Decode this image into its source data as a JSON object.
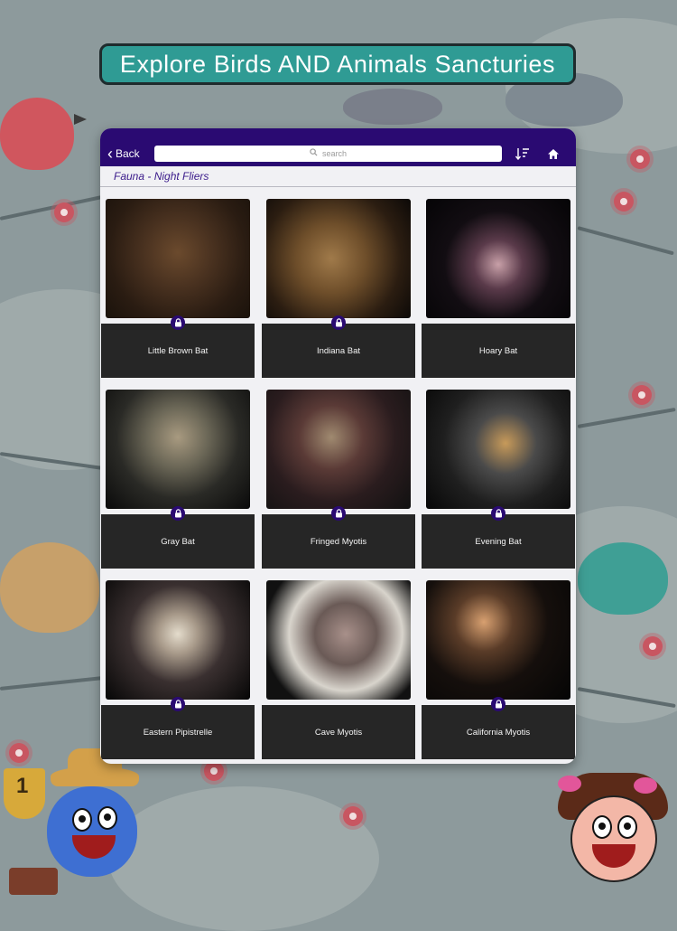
{
  "banner": {
    "title": "Explore Birds AND Animals Sancturies"
  },
  "nav": {
    "back_label": "Back",
    "search_placeholder": "search"
  },
  "breadcrumb": {
    "text": "Fauna - Night Fliers"
  },
  "colors": {
    "nav_bg": "#2a0a72",
    "banner_bg": "#2f9b94",
    "tile_label_bg": "#262626"
  },
  "icons": {
    "back": "chevron-left-icon",
    "search": "magnifier-icon",
    "sort": "sort-icon",
    "home": "home-icon",
    "lock": "lock-icon"
  },
  "items": [
    {
      "label": "Little Brown Bat",
      "locked": true
    },
    {
      "label": "Indiana Bat",
      "locked": true
    },
    {
      "label": "Hoary Bat",
      "locked": false
    },
    {
      "label": "Gray Bat",
      "locked": true
    },
    {
      "label": "Fringed Myotis",
      "locked": true
    },
    {
      "label": "Evening Bat",
      "locked": true
    },
    {
      "label": "Eastern Pipistrelle",
      "locked": true
    },
    {
      "label": "Cave Myotis",
      "locked": false
    },
    {
      "label": "California Myotis",
      "locked": true
    }
  ]
}
